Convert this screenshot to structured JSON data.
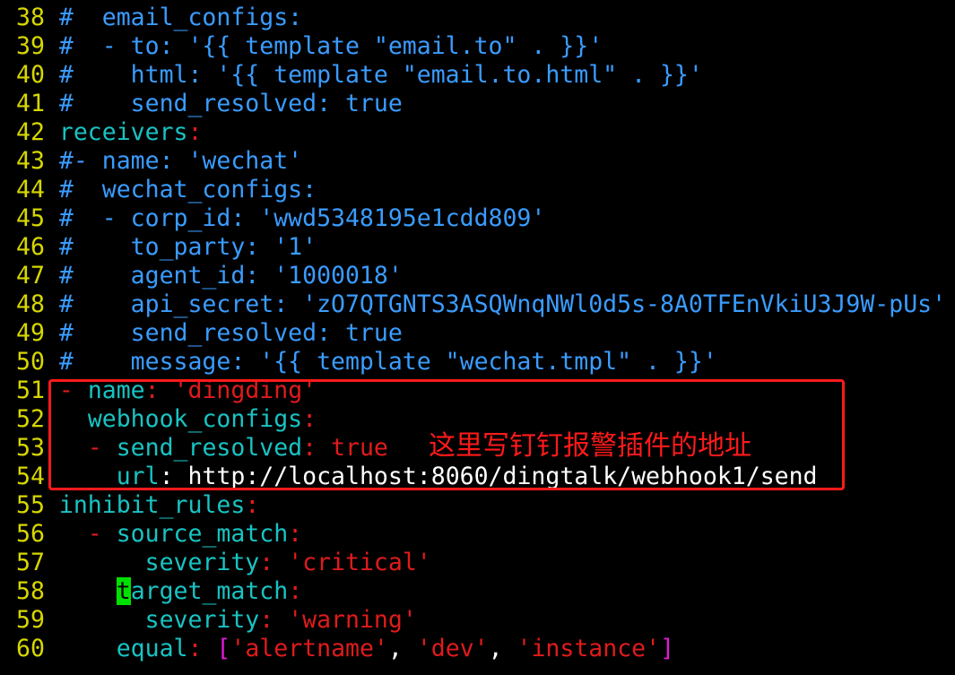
{
  "editor": {
    "colors": {
      "background": "#000000",
      "line_number": "#d7d700",
      "comment": "#3a9cff",
      "key": "#19c3c3",
      "string": "#e01b1b",
      "plain": "#ffffff",
      "cursor": "#00e000",
      "highlight_box": "#ff1a1a",
      "annotation": "#ff1a1a"
    },
    "lines": [
      {
        "num": "38",
        "segs": [
          {
            "t": "#  email_configs:",
            "c": "comment"
          }
        ]
      },
      {
        "num": "39",
        "segs": [
          {
            "t": "#  - to: '{{ template \"email.to\" . }}'",
            "c": "comment"
          }
        ]
      },
      {
        "num": "40",
        "segs": [
          {
            "t": "#    html: '{{ template \"email.to.html\" . }}'",
            "c": "comment"
          }
        ]
      },
      {
        "num": "41",
        "segs": [
          {
            "t": "#    send_resolved: true",
            "c": "comment"
          }
        ]
      },
      {
        "num": "42",
        "segs": [
          {
            "t": "receivers",
            "c": "key"
          },
          {
            "t": ":",
            "c": "string"
          }
        ]
      },
      {
        "num": "43",
        "segs": [
          {
            "t": "#- name: 'wechat'",
            "c": "comment"
          }
        ]
      },
      {
        "num": "44",
        "segs": [
          {
            "t": "#  wechat_configs:",
            "c": "comment"
          }
        ]
      },
      {
        "num": "45",
        "segs": [
          {
            "t": "#  - corp_id: 'wwd5348195e1cdd809'",
            "c": "comment"
          }
        ]
      },
      {
        "num": "46",
        "segs": [
          {
            "t": "#    to_party: '1'",
            "c": "comment"
          }
        ]
      },
      {
        "num": "47",
        "segs": [
          {
            "t": "#    agent_id: '1000018'",
            "c": "comment"
          }
        ]
      },
      {
        "num": "48",
        "segs": [
          {
            "t": "#    api_secret: 'zO7QTGNTS3ASQWnqNWl0d5s-8A0TFEnVkiU3J9W-pUs'",
            "c": "comment"
          }
        ]
      },
      {
        "num": "49",
        "segs": [
          {
            "t": "#    send_resolved: true",
            "c": "comment"
          }
        ]
      },
      {
        "num": "50",
        "segs": [
          {
            "t": "#    message: '{{ template \"wechat.tmpl\" . }}'",
            "c": "comment"
          }
        ]
      },
      {
        "num": "51",
        "segs": [
          {
            "t": "- ",
            "c": "string"
          },
          {
            "t": "name",
            "c": "key"
          },
          {
            "t": ": ",
            "c": "string"
          },
          {
            "t": "'dingding'",
            "c": "string"
          }
        ]
      },
      {
        "num": "52",
        "segs": [
          {
            "t": "  ",
            "c": "plain"
          },
          {
            "t": "webhook_configs",
            "c": "key"
          },
          {
            "t": ":",
            "c": "string"
          }
        ]
      },
      {
        "num": "53",
        "segs": [
          {
            "t": "  - ",
            "c": "string"
          },
          {
            "t": "send_resolved",
            "c": "key"
          },
          {
            "t": ": ",
            "c": "string"
          },
          {
            "t": "true",
            "c": "string"
          }
        ]
      },
      {
        "num": "54",
        "segs": [
          {
            "t": "    ",
            "c": "plain"
          },
          {
            "t": "url",
            "c": "key"
          },
          {
            "t": ": ",
            "c": "plain"
          },
          {
            "t": "http://localhost:8060/dingtalk/webhook1/send",
            "c": "plain"
          }
        ]
      },
      {
        "num": "55",
        "segs": [
          {
            "t": "inhibit_rules",
            "c": "key"
          },
          {
            "t": ":",
            "c": "string"
          }
        ]
      },
      {
        "num": "56",
        "segs": [
          {
            "t": "  - ",
            "c": "string"
          },
          {
            "t": "source_match",
            "c": "key"
          },
          {
            "t": ":",
            "c": "string"
          }
        ]
      },
      {
        "num": "57",
        "segs": [
          {
            "t": "      ",
            "c": "plain"
          },
          {
            "t": "severity",
            "c": "key"
          },
          {
            "t": ": ",
            "c": "string"
          },
          {
            "t": "'critical'",
            "c": "string"
          }
        ]
      },
      {
        "num": "58",
        "segs": [
          {
            "t": "    ",
            "c": "plain"
          },
          {
            "t": "t",
            "c": "cursor"
          },
          {
            "t": "arget_match",
            "c": "key"
          },
          {
            "t": ":",
            "c": "string"
          }
        ]
      },
      {
        "num": "59",
        "segs": [
          {
            "t": "      ",
            "c": "plain"
          },
          {
            "t": "severity",
            "c": "key"
          },
          {
            "t": ": ",
            "c": "string"
          },
          {
            "t": "'warning'",
            "c": "string"
          }
        ]
      },
      {
        "num": "60",
        "segs": [
          {
            "t": "    ",
            "c": "plain"
          },
          {
            "t": "equal",
            "c": "key"
          },
          {
            "t": ": ",
            "c": "string"
          },
          {
            "t": "[",
            "c": "magenta"
          },
          {
            "t": "'alertname'",
            "c": "string"
          },
          {
            "t": ", ",
            "c": "plain"
          },
          {
            "t": "'dev'",
            "c": "string"
          },
          {
            "t": ", ",
            "c": "plain"
          },
          {
            "t": "'instance'",
            "c": "string"
          },
          {
            "t": "]",
            "c": "magenta"
          }
        ]
      }
    ]
  },
  "annotation": {
    "text": "这里写钉钉报警插件的地址"
  }
}
